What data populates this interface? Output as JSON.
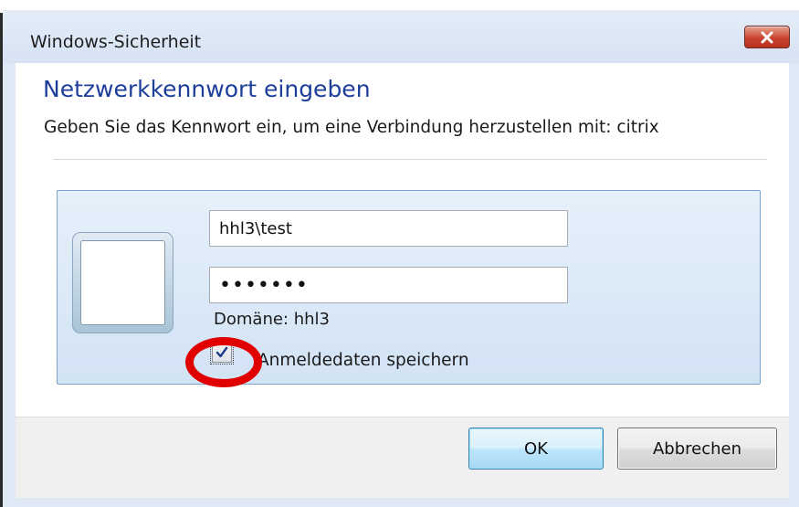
{
  "window": {
    "title": "Windows-Sicherheit",
    "close_icon": "close-x-icon"
  },
  "dialog": {
    "heading": "Netzwerkkennwort eingeben",
    "description": "Geben Sie das Kennwort ein, um eine Verbindung herzustellen mit: citrix"
  },
  "credentials": {
    "user_tile_icon": "user-tile-icon",
    "username_value": "hhl3\\test",
    "password_value": "•••••••",
    "domain_label": "Domäne: hhl3",
    "remember_checked": true,
    "remember_label": "Anmeldedaten speichern"
  },
  "buttons": {
    "ok_label": "OK",
    "cancel_label": "Abbrechen"
  },
  "annotation": {
    "highlight_color": "#e00000"
  },
  "colors": {
    "heading": "#1d3f9a",
    "titlebar": "#dfe9f5",
    "close_button": "#c8442f"
  }
}
